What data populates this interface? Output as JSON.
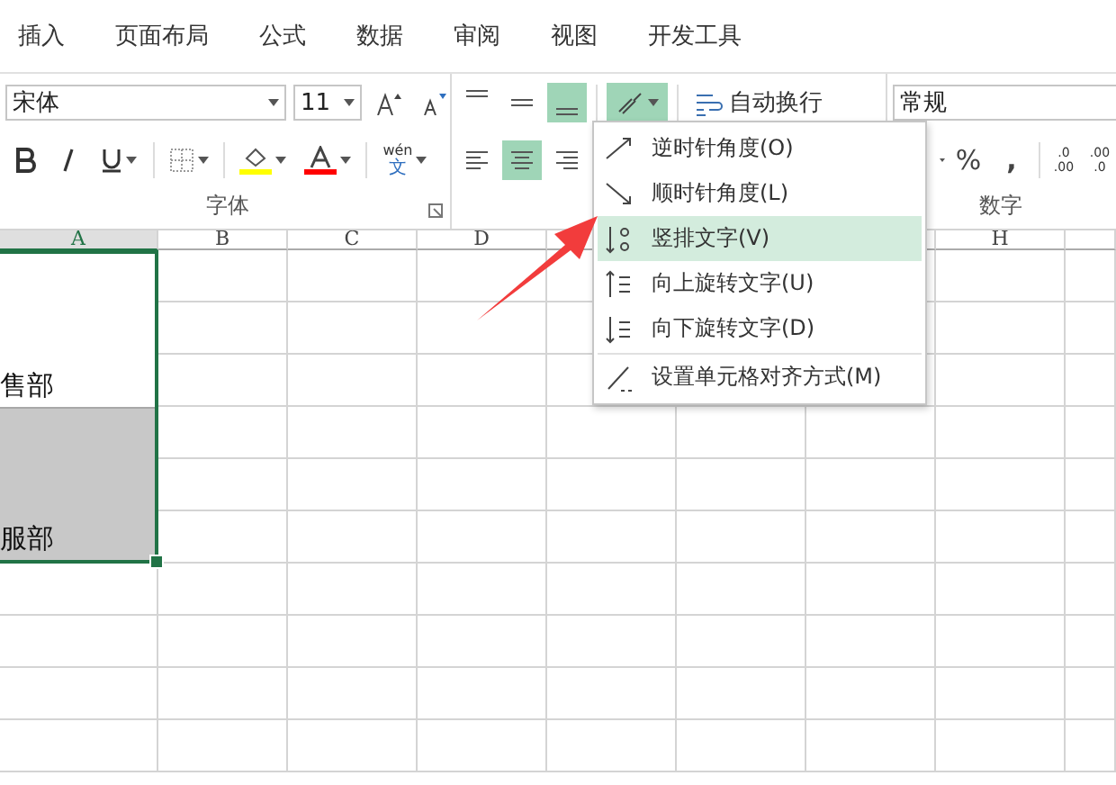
{
  "ribbon_tabs": [
    {
      "label": "插入"
    },
    {
      "label": "页面布局"
    },
    {
      "label": "公式"
    },
    {
      "label": "数据"
    },
    {
      "label": "审阅"
    },
    {
      "label": "视图"
    },
    {
      "label": "开发工具"
    }
  ],
  "font_group": {
    "font": "宋体",
    "size": "11",
    "phonetic_top": "wén",
    "phonetic_bottom": "文",
    "label": "字体"
  },
  "alignment_group": {
    "vertical": [
      {
        "kind": "top",
        "selected": false
      },
      {
        "kind": "middle",
        "selected": false
      },
      {
        "kind": "bottom",
        "selected": true
      }
    ],
    "horizontal": [
      {
        "kind": "left",
        "selected": false
      },
      {
        "kind": "center",
        "selected": true
      },
      {
        "kind": "right",
        "selected": false
      }
    ],
    "orientation_open": true,
    "wrap_text": "自动换行"
  },
  "number_group": {
    "format": "常规",
    "percent": "%",
    "comma": ",",
    "increase_decimal": [
      ".0",
      ".00"
    ],
    "decrease_decimal": [
      ".00",
      ".0"
    ],
    "label": "数字"
  },
  "orientation_menu": {
    "items": [
      {
        "kind": "ccw",
        "label": "逆时针角度(O)",
        "selected": false
      },
      {
        "kind": "cw",
        "label": "顺时针角度(L)",
        "selected": false
      },
      {
        "kind": "vertical",
        "label": "竖排文字(V)",
        "selected": true
      },
      {
        "kind": "up",
        "label": "向上旋转文字(U)",
        "selected": false
      },
      {
        "kind": "down",
        "label": "向下旋转文字(D)",
        "selected": false
      },
      {
        "kind": "format",
        "label": "设置单元格对齐方式(M)",
        "selected": false,
        "separator": true
      }
    ]
  },
  "sheet": {
    "columns": [
      {
        "label": "A",
        "selected": true
      },
      {
        "label": "B",
        "selected": false
      },
      {
        "label": "C",
        "selected": false
      },
      {
        "label": "D",
        "selected": false
      },
      {
        "label": "H",
        "selected": false
      }
    ],
    "merged_cells": [
      {
        "text": "售部",
        "shaded": false
      },
      {
        "text": "服部",
        "shaded": true
      }
    ]
  }
}
